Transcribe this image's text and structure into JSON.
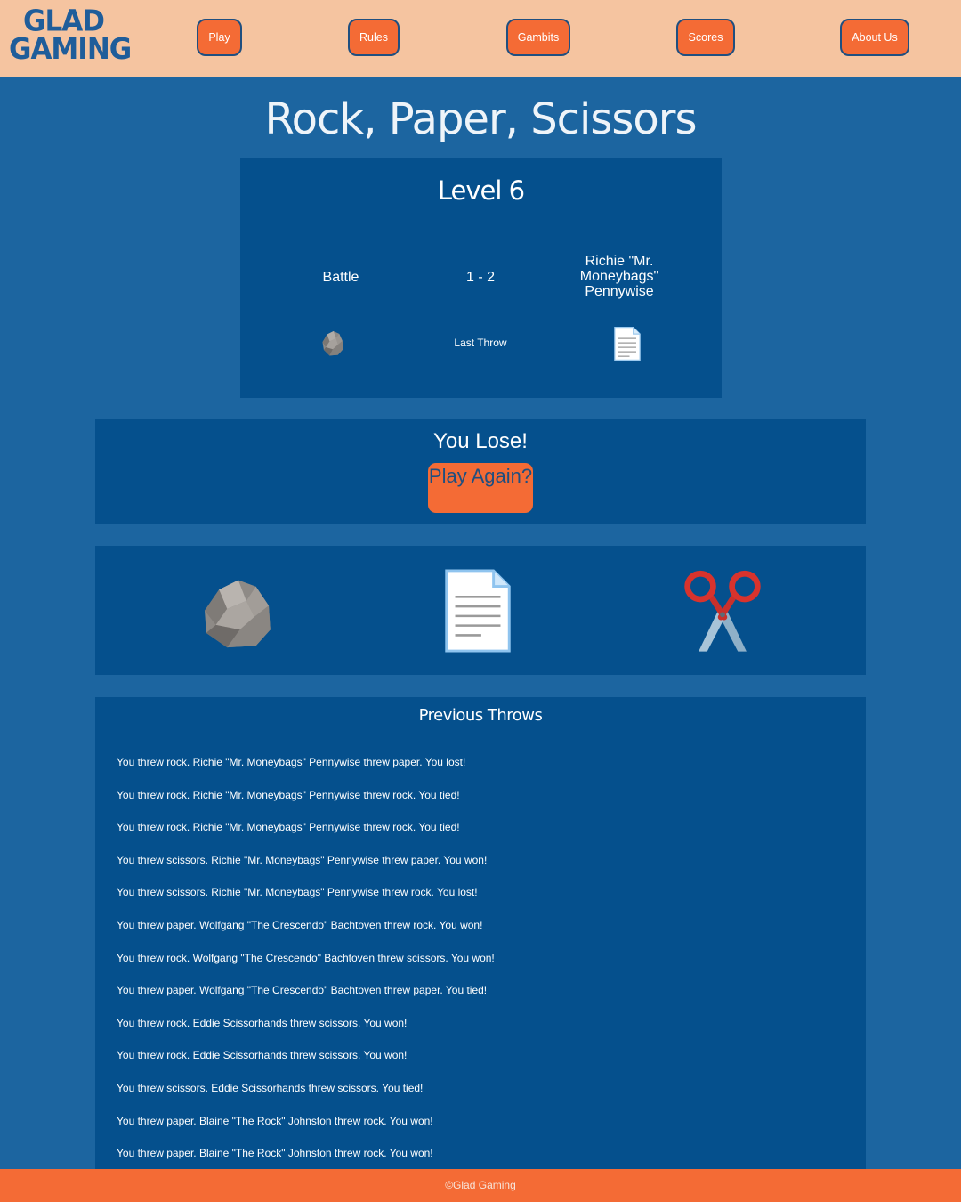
{
  "logo": {
    "line1": "GLAD",
    "line2": "GAMING"
  },
  "nav": [
    {
      "label": "Play"
    },
    {
      "label": "Rules"
    },
    {
      "label": "Gambits"
    },
    {
      "label": "Scores"
    },
    {
      "label": "About Us"
    }
  ],
  "title": "Rock, Paper, Scissors",
  "level": {
    "title": "Level 6",
    "player_name": "Battle",
    "score": "1 - 2",
    "opponent_name": "Richie \"Mr. Moneybags\" Pennywise",
    "last_throw_label": "Last Throw",
    "player_last_throw_icon": "rock-icon",
    "opponent_last_throw_icon": "paper-icon"
  },
  "result": {
    "message": "You Lose!",
    "play_again_label": "Play Again?"
  },
  "choices": [
    {
      "icon": "rock-icon"
    },
    {
      "icon": "paper-icon"
    },
    {
      "icon": "scissors-icon"
    }
  ],
  "history": {
    "title": "Previous Throws",
    "items": [
      "You threw rock. Richie \"Mr. Moneybags\" Pennywise threw paper. You lost!",
      "You threw rock. Richie \"Mr. Moneybags\" Pennywise threw rock. You tied!",
      "You threw rock. Richie \"Mr. Moneybags\" Pennywise threw rock. You tied!",
      "You threw scissors. Richie \"Mr. Moneybags\" Pennywise threw paper. You won!",
      "You threw scissors. Richie \"Mr. Moneybags\" Pennywise threw rock. You lost!",
      "You threw paper. Wolfgang \"The Crescendo\" Bachtoven threw rock. You won!",
      "You threw rock. Wolfgang \"The Crescendo\" Bachtoven threw scissors. You won!",
      "You threw paper. Wolfgang \"The Crescendo\" Bachtoven threw paper. You tied!",
      "You threw rock. Eddie Scissorhands threw scissors. You won!",
      "You threw rock. Eddie Scissorhands threw scissors. You won!",
      "You threw scissors. Eddie Scissorhands threw scissors. You tied!",
      "You threw paper. Blaine \"The Rock\" Johnston threw rock. You won!",
      "You threw paper. Blaine \"The Rock\" Johnston threw rock. You won!"
    ]
  },
  "footer": {
    "text": "©Glad Gaming"
  },
  "colors": {
    "header_bg": "#f5c4a0",
    "page_bg": "#1c65a0",
    "panel_bg": "#05508d",
    "accent": "#f46b35",
    "brand_blue": "#1f5d9a"
  }
}
